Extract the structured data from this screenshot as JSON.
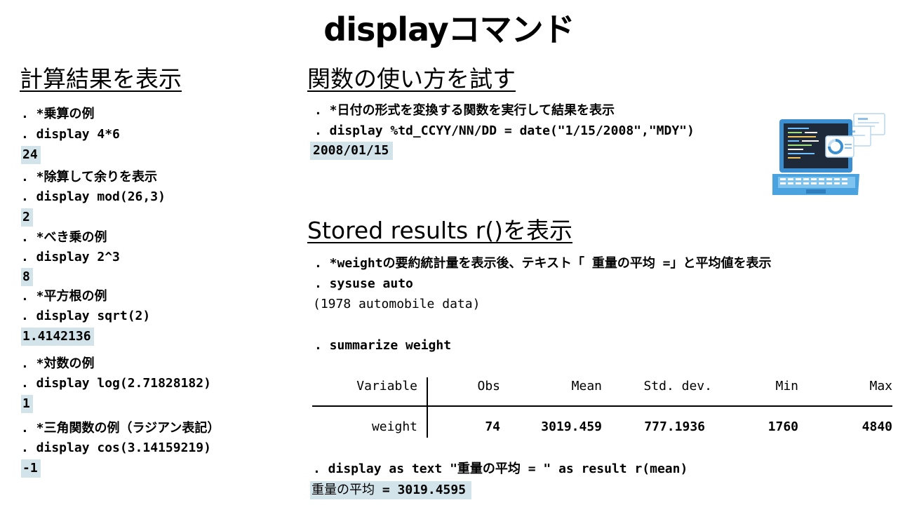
{
  "title": "displayコマンド",
  "left_section": {
    "heading": "計算結果を表示",
    "lines": [
      {
        "text": ". *乗算の例",
        "kind": "cmd"
      },
      {
        "text": ". display 4*6",
        "kind": "cmd"
      },
      {
        "text": "24",
        "kind": "out"
      },
      {
        "text": ". *除算して余りを表示",
        "kind": "cmd"
      },
      {
        "text": ". display mod(26,3)",
        "kind": "cmd"
      },
      {
        "text": "2",
        "kind": "out"
      },
      {
        "text": ". *べき乗の例",
        "kind": "cmd"
      },
      {
        "text": ". display 2^3",
        "kind": "cmd"
      },
      {
        "text": "8",
        "kind": "out"
      },
      {
        "text": ". *平方根の例",
        "kind": "cmd"
      },
      {
        "text": ". display sqrt(2)",
        "kind": "cmd"
      },
      {
        "text": "1.4142136",
        "kind": "out"
      },
      {
        "text": ". *対数の例",
        "kind": "cmd"
      },
      {
        "text": ". display log(2.71828182)",
        "kind": "cmd"
      },
      {
        "text": "1",
        "kind": "out"
      },
      {
        "text": ". *三角関数の例（ラジアン表記）",
        "kind": "cmd"
      },
      {
        "text": ". display cos(3.14159219)",
        "kind": "cmd"
      },
      {
        "text": "-1",
        "kind": "out"
      }
    ]
  },
  "function_section": {
    "heading": "関数の使い方を試す",
    "lines": [
      {
        "text": ". *日付の形式を変換する関数を実行して結果を表示",
        "kind": "cmd"
      },
      {
        "text": ". display %td_CCYY/NN/DD = date(\"1/15/2008\",\"MDY\")",
        "kind": "cmd"
      },
      {
        "text": " 2008/01/15 ",
        "kind": "out"
      }
    ]
  },
  "stored_section": {
    "heading": "Stored results r()を表示",
    "comment": ". *weightの要約統計量を表示後、テキスト「 重量の平均 =」と平均値を表示",
    "sysuse": ". sysuse auto",
    "sysuse_note": "(1978 automobile data)",
    "summarize": ". summarize weight",
    "table": {
      "headers": [
        "Variable",
        "Obs",
        "Mean",
        "Std. dev.",
        "Min",
        "Max"
      ],
      "row": [
        "weight",
        "74",
        "3019.459",
        "777.1936",
        "1760",
        "4840"
      ]
    },
    "display_cmd": ". display as text \"重量の平均 = \" as result r(mean)",
    "display_label": "重量の平均 ",
    "display_value": "= 3019.4595"
  },
  "colors": {
    "output_highlight": "#d2e3ea",
    "laptop_body": "#4aa3df",
    "laptop_screen": "#1e2a3a"
  },
  "icons": [
    "laptop-icon"
  ]
}
